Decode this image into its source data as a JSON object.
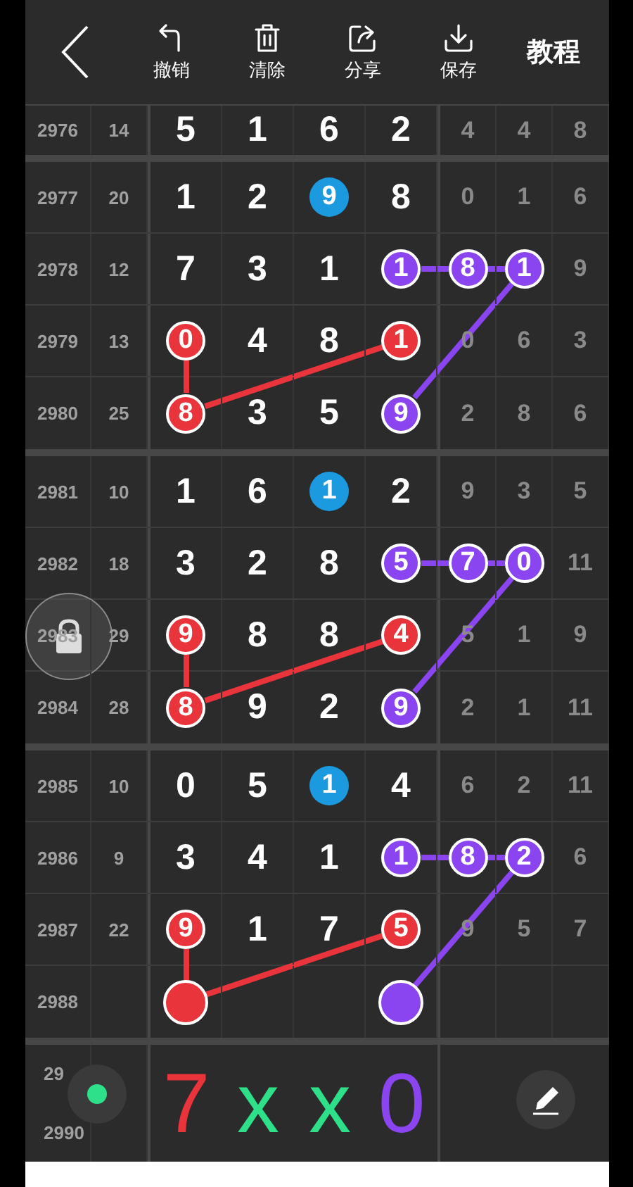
{
  "toolbar": {
    "actions": [
      {
        "kind": "undo",
        "label": "撤销"
      },
      {
        "kind": "clear",
        "label": "清除"
      },
      {
        "kind": "share",
        "label": "分享"
      },
      {
        "kind": "save",
        "label": "保存"
      }
    ],
    "help": "教程"
  },
  "groups": [
    {
      "rows": [
        {
          "issue": "2976",
          "count": "14",
          "cells": [
            {
              "digit": "5"
            },
            {
              "digit": "1"
            },
            {
              "digit": "6"
            },
            {
              "digit": "2"
            },
            {
              "digit": "4"
            },
            {
              "digit": "4"
            },
            {
              "digit": "8"
            }
          ]
        }
      ]
    },
    {
      "traces": [
        {
          "color": "#e8343a",
          "kind": "column-first"
        },
        {
          "color": "#8a44f0",
          "kind": "row-first"
        }
      ],
      "rows": [
        {
          "issue": "2977",
          "count": "20",
          "cells": [
            {
              "digit": "1"
            },
            {
              "digit": "2"
            },
            {
              "digit": "9",
              "color": "#1b9ae0",
              "ring": false
            },
            {
              "digit": "8"
            },
            {
              "digit": "0"
            },
            {
              "digit": "1"
            },
            {
              "digit": "6"
            }
          ]
        },
        {
          "issue": "2978",
          "count": "12",
          "cells": [
            {
              "digit": "7"
            },
            {
              "digit": "3"
            },
            {
              "digit": "1"
            },
            {
              "digit": "1",
              "color": "#8a44f0",
              "ring": true
            },
            {
              "digit": "8",
              "color": "#8a44f0",
              "ring": true
            },
            {
              "digit": "1",
              "color": "#8a44f0",
              "ring": true
            },
            {
              "digit": "9"
            }
          ]
        },
        {
          "issue": "2979",
          "count": "13",
          "cells": [
            {
              "digit": "0",
              "color": "#e8343a",
              "ring": true
            },
            {
              "digit": "4"
            },
            {
              "digit": "8"
            },
            {
              "digit": "1",
              "color": "#e8343a",
              "ring": true
            },
            {
              "digit": "0"
            },
            {
              "digit": "6"
            },
            {
              "digit": "3"
            }
          ]
        },
        {
          "issue": "2980",
          "count": "25",
          "cells": [
            {
              "digit": "8",
              "color": "#e8343a",
              "ring": true
            },
            {
              "digit": "3"
            },
            {
              "digit": "5"
            },
            {
              "digit": "9",
              "color": "#8a44f0",
              "ring": true
            },
            {
              "digit": "2"
            },
            {
              "digit": "8"
            },
            {
              "digit": "6"
            }
          ]
        }
      ]
    },
    {
      "traces": [
        {
          "color": "#e8343a",
          "kind": "column-first"
        },
        {
          "color": "#8a44f0",
          "kind": "row-first"
        }
      ],
      "rows": [
        {
          "issue": "2981",
          "count": "10",
          "cells": [
            {
              "digit": "1"
            },
            {
              "digit": "6"
            },
            {
              "digit": "1",
              "color": "#1b9ae0",
              "ring": false
            },
            {
              "digit": "2"
            },
            {
              "digit": "9"
            },
            {
              "digit": "3"
            },
            {
              "digit": "5"
            }
          ]
        },
        {
          "issue": "2982",
          "count": "18",
          "cells": [
            {
              "digit": "3"
            },
            {
              "digit": "2"
            },
            {
              "digit": "8"
            },
            {
              "digit": "5",
              "color": "#8a44f0",
              "ring": true
            },
            {
              "digit": "7",
              "color": "#8a44f0",
              "ring": true
            },
            {
              "digit": "0",
              "color": "#8a44f0",
              "ring": true
            },
            {
              "digit": "11"
            }
          ]
        },
        {
          "issue": "2983",
          "count": "29",
          "cells": [
            {
              "digit": "9",
              "color": "#e8343a",
              "ring": true
            },
            {
              "digit": "8"
            },
            {
              "digit": "8"
            },
            {
              "digit": "4",
              "color": "#e8343a",
              "ring": true
            },
            {
              "digit": "5"
            },
            {
              "digit": "1"
            },
            {
              "digit": "9"
            }
          ]
        },
        {
          "issue": "2984",
          "count": "28",
          "cells": [
            {
              "digit": "8",
              "color": "#e8343a",
              "ring": true
            },
            {
              "digit": "9"
            },
            {
              "digit": "2"
            },
            {
              "digit": "9",
              "color": "#8a44f0",
              "ring": true
            },
            {
              "digit": "2"
            },
            {
              "digit": "1"
            },
            {
              "digit": "11"
            }
          ]
        }
      ]
    },
    {
      "traces": [
        {
          "color": "#e8343a",
          "kind": "column-first"
        },
        {
          "color": "#8a44f0",
          "kind": "row-first"
        }
      ],
      "rows": [
        {
          "issue": "2985",
          "count": "10",
          "cells": [
            {
              "digit": "0"
            },
            {
              "digit": "5"
            },
            {
              "digit": "1",
              "color": "#1b9ae0",
              "ring": false
            },
            {
              "digit": "4"
            },
            {
              "digit": "6"
            },
            {
              "digit": "2"
            },
            {
              "digit": "11"
            }
          ]
        },
        {
          "issue": "2986",
          "count": "9",
          "cells": [
            {
              "digit": "3"
            },
            {
              "digit": "4"
            },
            {
              "digit": "1"
            },
            {
              "digit": "1",
              "color": "#8a44f0",
              "ring": true
            },
            {
              "digit": "8",
              "color": "#8a44f0",
              "ring": true
            },
            {
              "digit": "2",
              "color": "#8a44f0",
              "ring": true
            },
            {
              "digit": "6"
            }
          ]
        },
        {
          "issue": "2987",
          "count": "22",
          "cells": [
            {
              "digit": "9",
              "color": "#e8343a",
              "ring": true
            },
            {
              "digit": "1"
            },
            {
              "digit": "7"
            },
            {
              "digit": "5",
              "color": "#e8343a",
              "ring": true
            },
            {
              "digit": "9"
            },
            {
              "digit": "5"
            },
            {
              "digit": "7"
            }
          ]
        },
        {
          "issue": "2988",
          "cells": [
            {
              "color": "#e8343a",
              "ring": true
            },
            {},
            {},
            {
              "color": "#8a44f0",
              "ring": true
            },
            {},
            {},
            {}
          ]
        }
      ]
    }
  ],
  "notes_group": {
    "issues": [
      "29",
      "2990"
    ],
    "notes": [
      {
        "text": "7",
        "color": "#e8343a"
      },
      {
        "text": "x",
        "color": "#2ee08a"
      },
      {
        "text": "x",
        "color": "#2ee08a"
      },
      {
        "text": "0",
        "color": "#8a44f0"
      }
    ]
  },
  "pen_color": {
    "color": "#2ee08a"
  }
}
